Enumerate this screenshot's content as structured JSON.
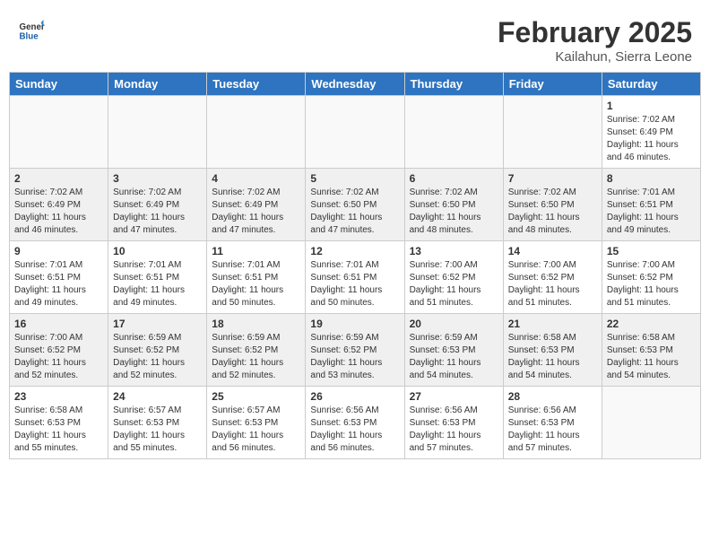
{
  "header": {
    "logo_general": "General",
    "logo_blue": "Blue",
    "month_title": "February 2025",
    "location": "Kailahun, Sierra Leone"
  },
  "weekdays": [
    "Sunday",
    "Monday",
    "Tuesday",
    "Wednesday",
    "Thursday",
    "Friday",
    "Saturday"
  ],
  "weeks": [
    [
      {
        "day": null
      },
      {
        "day": null
      },
      {
        "day": null
      },
      {
        "day": null
      },
      {
        "day": null
      },
      {
        "day": null
      },
      {
        "day": "1",
        "sunrise": "7:02 AM",
        "sunset": "6:49 PM",
        "daylight": "11 hours and 46 minutes."
      }
    ],
    [
      {
        "day": "2",
        "sunrise": "7:02 AM",
        "sunset": "6:49 PM",
        "daylight": "11 hours and 46 minutes."
      },
      {
        "day": "3",
        "sunrise": "7:02 AM",
        "sunset": "6:49 PM",
        "daylight": "11 hours and 47 minutes."
      },
      {
        "day": "4",
        "sunrise": "7:02 AM",
        "sunset": "6:49 PM",
        "daylight": "11 hours and 47 minutes."
      },
      {
        "day": "5",
        "sunrise": "7:02 AM",
        "sunset": "6:50 PM",
        "daylight": "11 hours and 47 minutes."
      },
      {
        "day": "6",
        "sunrise": "7:02 AM",
        "sunset": "6:50 PM",
        "daylight": "11 hours and 48 minutes."
      },
      {
        "day": "7",
        "sunrise": "7:02 AM",
        "sunset": "6:50 PM",
        "daylight": "11 hours and 48 minutes."
      },
      {
        "day": "8",
        "sunrise": "7:01 AM",
        "sunset": "6:51 PM",
        "daylight": "11 hours and 49 minutes."
      }
    ],
    [
      {
        "day": "9",
        "sunrise": "7:01 AM",
        "sunset": "6:51 PM",
        "daylight": "11 hours and 49 minutes."
      },
      {
        "day": "10",
        "sunrise": "7:01 AM",
        "sunset": "6:51 PM",
        "daylight": "11 hours and 49 minutes."
      },
      {
        "day": "11",
        "sunrise": "7:01 AM",
        "sunset": "6:51 PM",
        "daylight": "11 hours and 50 minutes."
      },
      {
        "day": "12",
        "sunrise": "7:01 AM",
        "sunset": "6:51 PM",
        "daylight": "11 hours and 50 minutes."
      },
      {
        "day": "13",
        "sunrise": "7:00 AM",
        "sunset": "6:52 PM",
        "daylight": "11 hours and 51 minutes."
      },
      {
        "day": "14",
        "sunrise": "7:00 AM",
        "sunset": "6:52 PM",
        "daylight": "11 hours and 51 minutes."
      },
      {
        "day": "15",
        "sunrise": "7:00 AM",
        "sunset": "6:52 PM",
        "daylight": "11 hours and 51 minutes."
      }
    ],
    [
      {
        "day": "16",
        "sunrise": "7:00 AM",
        "sunset": "6:52 PM",
        "daylight": "11 hours and 52 minutes."
      },
      {
        "day": "17",
        "sunrise": "6:59 AM",
        "sunset": "6:52 PM",
        "daylight": "11 hours and 52 minutes."
      },
      {
        "day": "18",
        "sunrise": "6:59 AM",
        "sunset": "6:52 PM",
        "daylight": "11 hours and 52 minutes."
      },
      {
        "day": "19",
        "sunrise": "6:59 AM",
        "sunset": "6:52 PM",
        "daylight": "11 hours and 53 minutes."
      },
      {
        "day": "20",
        "sunrise": "6:59 AM",
        "sunset": "6:53 PM",
        "daylight": "11 hours and 54 minutes."
      },
      {
        "day": "21",
        "sunrise": "6:58 AM",
        "sunset": "6:53 PM",
        "daylight": "11 hours and 54 minutes."
      },
      {
        "day": "22",
        "sunrise": "6:58 AM",
        "sunset": "6:53 PM",
        "daylight": "11 hours and 54 minutes."
      }
    ],
    [
      {
        "day": "23",
        "sunrise": "6:58 AM",
        "sunset": "6:53 PM",
        "daylight": "11 hours and 55 minutes."
      },
      {
        "day": "24",
        "sunrise": "6:57 AM",
        "sunset": "6:53 PM",
        "daylight": "11 hours and 55 minutes."
      },
      {
        "day": "25",
        "sunrise": "6:57 AM",
        "sunset": "6:53 PM",
        "daylight": "11 hours and 56 minutes."
      },
      {
        "day": "26",
        "sunrise": "6:56 AM",
        "sunset": "6:53 PM",
        "daylight": "11 hours and 56 minutes."
      },
      {
        "day": "27",
        "sunrise": "6:56 AM",
        "sunset": "6:53 PM",
        "daylight": "11 hours and 57 minutes."
      },
      {
        "day": "28",
        "sunrise": "6:56 AM",
        "sunset": "6:53 PM",
        "daylight": "11 hours and 57 minutes."
      },
      {
        "day": null
      }
    ]
  ]
}
